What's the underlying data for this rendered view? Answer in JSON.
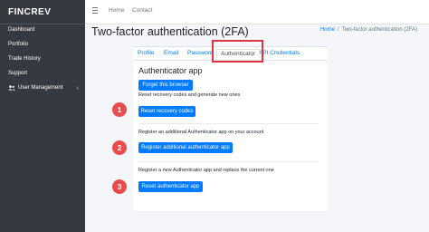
{
  "brand": {
    "name": "FINCREV"
  },
  "sidebar": {
    "items": [
      {
        "label": "Dashboard"
      },
      {
        "label": "Portfolio"
      },
      {
        "label": "Trade History"
      },
      {
        "label": "Support"
      },
      {
        "label": "User Management"
      }
    ]
  },
  "topbar": {
    "home": "Home",
    "contact": "Contact"
  },
  "page": {
    "title": "Two-factor authentication (2FA)"
  },
  "breadcrumb": {
    "home": "Home",
    "sep": "/",
    "current": "Two-factor authentication (2FA)"
  },
  "tabs": [
    {
      "label": "Profile"
    },
    {
      "label": "Email"
    },
    {
      "label": "Password"
    },
    {
      "label": "Authenticator",
      "active": true
    },
    {
      "label": "API Credentials"
    }
  ],
  "authenticator": {
    "title": "Authenticator app",
    "forget_button": "Forget this browser",
    "reset_desc": "Reset recovery codes and generate new ones",
    "reset_button": "Reset recovery codes",
    "register_desc": "Register an additional Authenticator app on your account",
    "register_button": "Register additional authenticator app",
    "replace_desc": "Register a new Authenticator app and replace the current one",
    "replace_button": "Reset authenticator app"
  },
  "markers": [
    "1",
    "2",
    "3"
  ],
  "colors": {
    "primary": "#007bff",
    "sidebar": "#343a40",
    "marker": "#e84c4c",
    "highlight": "#dc3545"
  }
}
